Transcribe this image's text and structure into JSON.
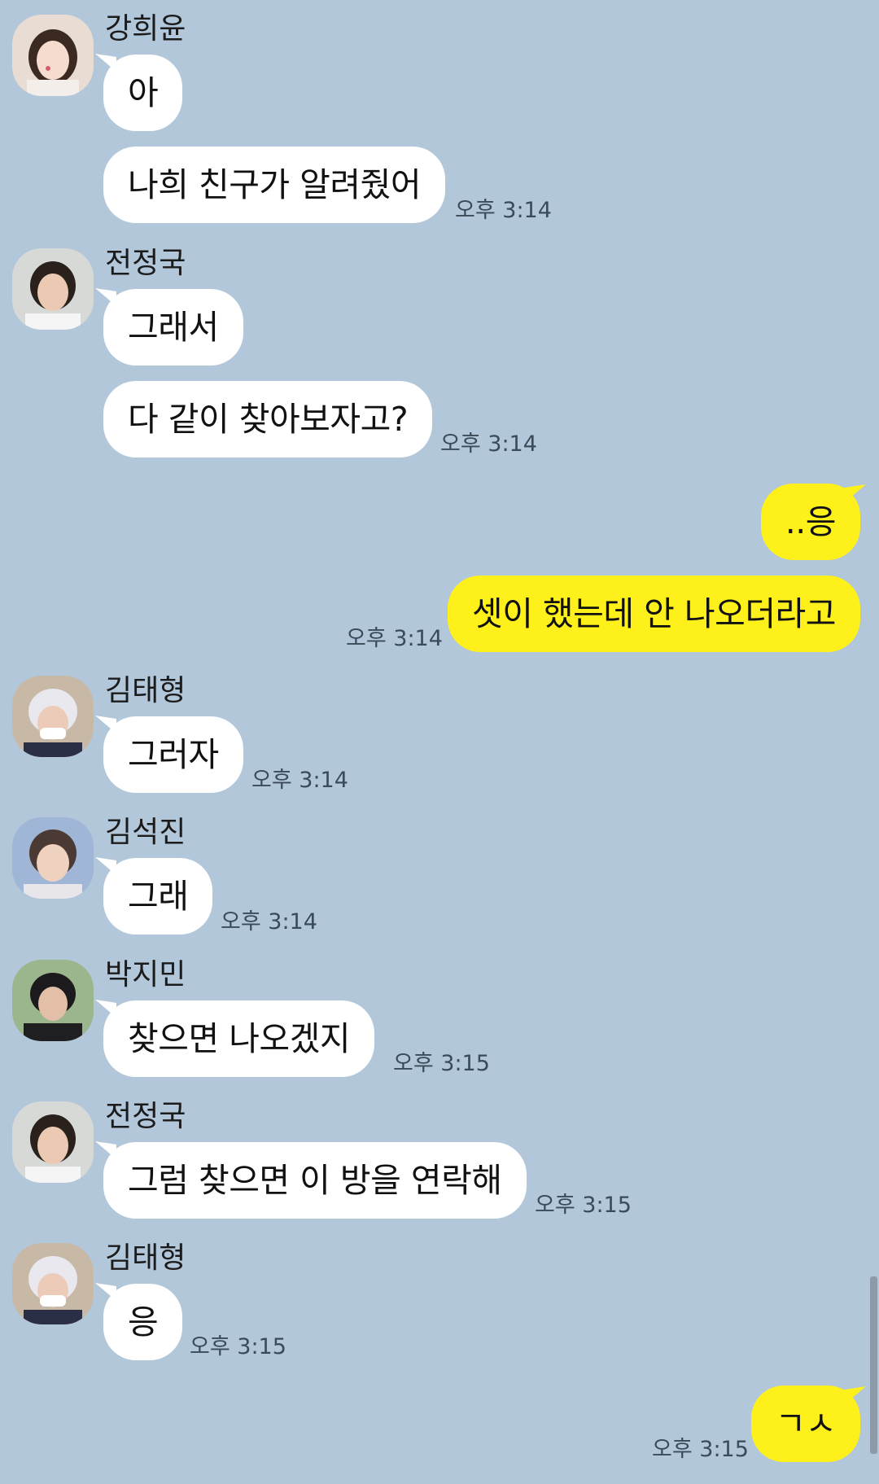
{
  "chat": {
    "messages": [
      {
        "sender": "강희윤",
        "text": "아"
      },
      {
        "text": "나희 친구가 알려줬어",
        "time": "오후 3:14"
      },
      {
        "sender": "전정국",
        "text": "그래서"
      },
      {
        "text": "다 같이 찾아보자고?",
        "time": "오후 3:14"
      },
      {
        "text": "..응"
      },
      {
        "text": "셋이 했는데 안 나오더라고",
        "time": "오후 3:14"
      },
      {
        "sender": "김태형",
        "text": "그러자",
        "time": "오후 3:14"
      },
      {
        "sender": "김석진",
        "text": "그래",
        "time": "오후 3:14"
      },
      {
        "sender": "박지민",
        "text": "찾으면 나오겠지",
        "time": "오후 3:15"
      },
      {
        "sender": "전정국",
        "text": "그럼 찾으면 이 방을 연락해",
        "time": "오후 3:15"
      },
      {
        "sender": "김태형",
        "text": "응",
        "time": "오후 3:15"
      },
      {
        "text": "ㄱㅅ",
        "time": "오후 3:15"
      }
    ]
  },
  "colors": {
    "background": "#b2c7da",
    "incoming_bubble": "#ffffff",
    "outgoing_bubble": "#fef01b",
    "timestamp": "#3b4a59"
  }
}
